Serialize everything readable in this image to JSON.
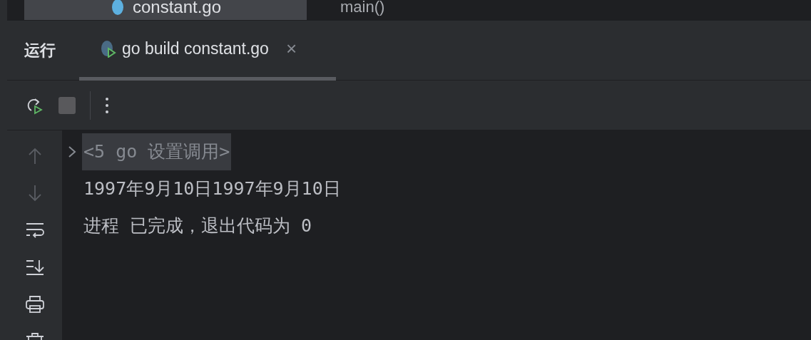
{
  "editor_tabs": [
    {
      "label": "constant.go",
      "selected": true
    }
  ],
  "breadcrumb": "main()",
  "run_panel": {
    "title": "运行",
    "tabs": [
      {
        "label": "go build constant.go",
        "selected": true,
        "close": "×"
      }
    ],
    "toolbar": [
      {
        "kind": "rerun",
        "disabled": false
      },
      {
        "kind": "stop",
        "disabled": true
      },
      {
        "kind": "more",
        "disabled": false
      }
    ],
    "gutter": [
      {
        "kind": "up",
        "disabled": true
      },
      {
        "kind": "down",
        "disabled": true
      },
      {
        "kind": "wrap",
        "disabled": false
      },
      {
        "kind": "scroll_end",
        "disabled": false
      },
      {
        "kind": "print",
        "disabled": false
      },
      {
        "kind": "clear",
        "disabled": false
      }
    ],
    "console": [
      {
        "kind": "fold",
        "text": "<5 go 设置调用>",
        "expanded": false
      },
      {
        "kind": "output",
        "text": "1997年9月10日1997年9月10日"
      },
      {
        "kind": "output",
        "text": "进程 已完成，退出代码为 0"
      }
    ]
  }
}
